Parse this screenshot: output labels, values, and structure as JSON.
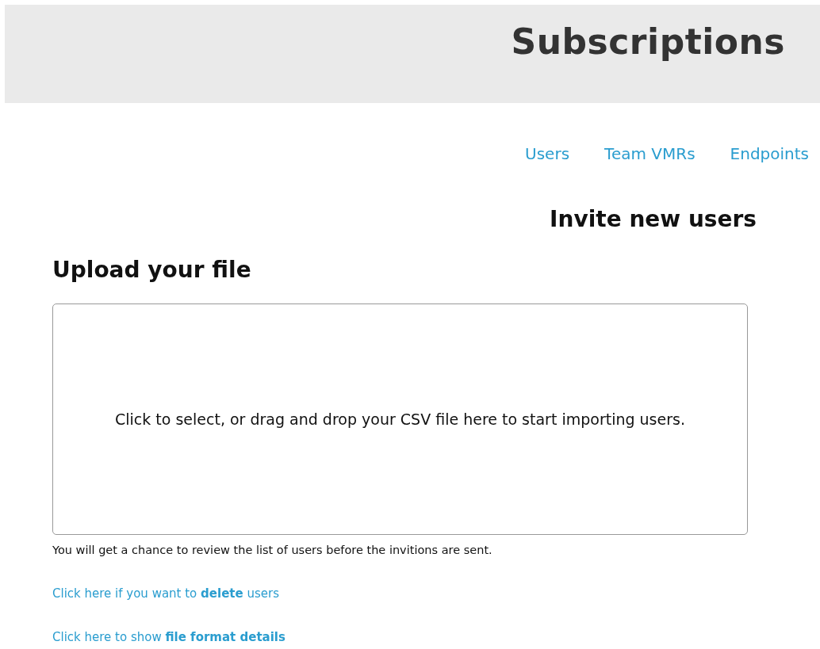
{
  "header": {
    "title": "Subscriptions"
  },
  "nav": [
    {
      "label": "Users"
    },
    {
      "label": "Team VMRs"
    },
    {
      "label": "Endpoints"
    }
  ],
  "page_title": "Invite new users",
  "upload": {
    "heading": "Upload your file",
    "dropzone_text": "Click to select, or drag and drop your CSV file here to start importing users.",
    "note": "You will get a chance to review the list of users before the invitions are sent."
  },
  "links": [
    "Click here if you want to **delete** users",
    "Click here to show **file format details**"
  ]
}
